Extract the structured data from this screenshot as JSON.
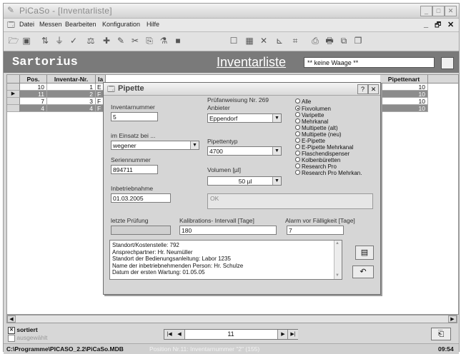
{
  "window": {
    "title": "PiCaSo - [Inventarliste]",
    "minimize_glyph": "_",
    "maximize_glyph": "□",
    "close_glyph": "✕",
    "mdi_min": "_",
    "mdi_max": "🗗",
    "mdi_close": "✕"
  },
  "menu": [
    "Datei",
    "Messen",
    "Bearbeiten",
    "Konfiguration",
    "Hilfe"
  ],
  "toolbar_icons": [
    "open-folder-icon",
    "save-icon",
    "sort-az-icon",
    "filter-icon",
    "check-icon",
    "scale-icon",
    "add-record-icon",
    "edit-record-icon",
    "delete-record-icon",
    "copy-record-icon",
    "weight-icon",
    "stop-icon",
    "window-icon",
    "grid-icon",
    "tools-icon",
    "chart-icon",
    "report-icon",
    "print-preview-icon",
    "printer-icon",
    "export-icon"
  ],
  "header": {
    "brand": "Sartorius",
    "list_title": "Inventarliste",
    "scale_value": "** keine Waage **"
  },
  "grid": {
    "columns": [
      "Pos.",
      "Inventar-Nr.",
      "Ia",
      "Pipettenart"
    ],
    "rows": [
      {
        "pos": "10",
        "inv": "1",
        "ia": "E",
        "art": "10",
        "current": false
      },
      {
        "pos": "11",
        "inv": "2",
        "ia": "F",
        "art": "10",
        "current": true
      },
      {
        "pos": "7",
        "inv": "3",
        "ia": "F",
        "art": "10",
        "current": false
      },
      {
        "pos": "4",
        "inv": "4",
        "ia": "F",
        "art": "10",
        "current": false
      }
    ]
  },
  "dialog": {
    "title": "Pipette",
    "inventarnummer_label": "Inventarnummer",
    "inventarnummer_value": "5",
    "einsatz_label": "im Einsatz bei ...",
    "einsatz_value": "wegener",
    "serien_label": "Seriennummer",
    "serien_value": "894711",
    "inbetrieb_label": "Inbetriebnahme",
    "inbetrieb_value": "01.03.2005",
    "pruef_label": "Prüfanweisung Nr. 269",
    "anbieter_label": "Anbieter",
    "anbieter_value": "Eppendorf",
    "typ_label": "Pipettentyp",
    "typ_value": "4700",
    "volumen_label": "Volumen [µl]",
    "volumen_value": "50 µl",
    "ok_text": "OK",
    "radio_options": [
      {
        "label": "Alle",
        "checked": false
      },
      {
        "label": "Fixvolumen",
        "checked": true
      },
      {
        "label": "Varipette",
        "checked": false
      },
      {
        "label": "Mehrkanal",
        "checked": false
      },
      {
        "label": "Multipette (alt)",
        "checked": false
      },
      {
        "label": "Multipette (neu)",
        "checked": false
      },
      {
        "label": "E-Pipette",
        "checked": false
      },
      {
        "label": "E-Pipette Mehrkanal",
        "checked": false
      },
      {
        "label": "Flaschendispenser",
        "checked": false
      },
      {
        "label": "Kolbenbüretten",
        "checked": false
      },
      {
        "label": "Research Pro",
        "checked": false
      },
      {
        "label": "Research Pro Mehrkan.",
        "checked": false
      }
    ],
    "letzte_label": "letzte Prüfung",
    "letzte_value": "",
    "kal_label": "Kalibrations- Intervall [Tage]",
    "kal_value": "180",
    "alarm_label": "Alarm vor Fälligkeit [Tage]",
    "alarm_value": "7",
    "notes": [
      "Standort/Kostenstelle: 792",
      "Ansprechpartner: Hr. Neumüller",
      "Standort der Bedienungsanleitung: Labor 1235",
      "Name der inbetriebnehmenden Person: Hr. Schulze",
      "Datum der ersten Wartung: 01.05.05"
    ],
    "help_glyph": "?",
    "close_glyph": "✕"
  },
  "bottom": {
    "sortiert_label": "sortiert",
    "sortiert_checked": true,
    "ausgewaehlt_label": "ausgewählt",
    "ausgewaehlt_checked": false,
    "nav_value": "11",
    "first_glyph": "|◀",
    "prev_glyph": "◀",
    "next_glyph": "▶",
    "last_glyph": "▶|"
  },
  "status": {
    "path": "C:\\Programme\\PICASO_2.2\\PiCaSo.MDB",
    "position": "Position Nr.11: Inventarnummer \"2\" (155)",
    "time": "09:54"
  }
}
